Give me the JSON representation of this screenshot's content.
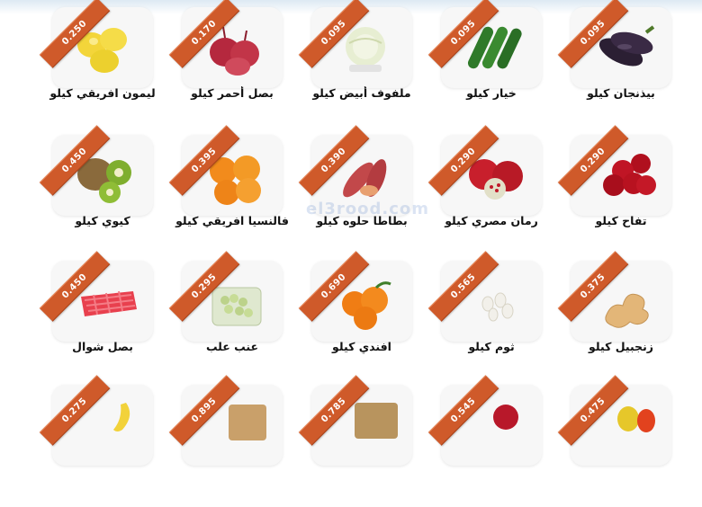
{
  "watermark": "el3rood.com",
  "rows": [
    [
      {
        "price": "0.250",
        "name": "ليمون افريقي كيلو",
        "icon": "lemon-icon"
      },
      {
        "price": "0.170",
        "name": "بصل أحمر كيلو",
        "icon": "red-onion-icon"
      },
      {
        "price": "0.095",
        "name": "ملفوف أبيض كيلو",
        "icon": "white-cabbage-icon"
      },
      {
        "price": "0.095",
        "name": "خيار كيلو",
        "icon": "cucumber-icon"
      },
      {
        "price": "0.095",
        "name": "بيذنجان كيلو",
        "icon": "eggplant-icon"
      }
    ],
    [
      {
        "price": "0.450",
        "name": "كيوي كيلو",
        "icon": "kiwi-icon"
      },
      {
        "price": "0.395",
        "name": "فالنسيا افريقي كيلو",
        "icon": "orange-icon"
      },
      {
        "price": "0.390",
        "name": "بطاطا حلوه كيلو",
        "icon": "sweet-potato-icon"
      },
      {
        "price": "0.290",
        "name": "رمان مصري كيلو",
        "icon": "pomegranate-icon"
      },
      {
        "price": "0.290",
        "name": "تفاح كيلو",
        "icon": "red-apple-icon"
      }
    ],
    [
      {
        "price": "0.450",
        "name": "بصل شوال",
        "icon": "onion-sack-icon"
      },
      {
        "price": "0.295",
        "name": "عنب علب",
        "icon": "grapes-box-icon"
      },
      {
        "price": "0.690",
        "name": "افندي كيلو",
        "icon": "tangerine-icon"
      },
      {
        "price": "0.565",
        "name": "ثوم كيلو",
        "icon": "garlic-icon"
      },
      {
        "price": "0.375",
        "name": "زنجبيل كيلو",
        "icon": "ginger-icon"
      }
    ],
    [
      {
        "price": "0.275",
        "name": "",
        "icon": "banana-icon"
      },
      {
        "price": "0.895",
        "name": "",
        "icon": "potato-box-icon"
      },
      {
        "price": "0.785",
        "name": "",
        "icon": "dates-box-icon"
      },
      {
        "price": "0.545",
        "name": "",
        "icon": "apple-icon"
      },
      {
        "price": "0.475",
        "name": "",
        "icon": "pepper-icon"
      }
    ]
  ]
}
